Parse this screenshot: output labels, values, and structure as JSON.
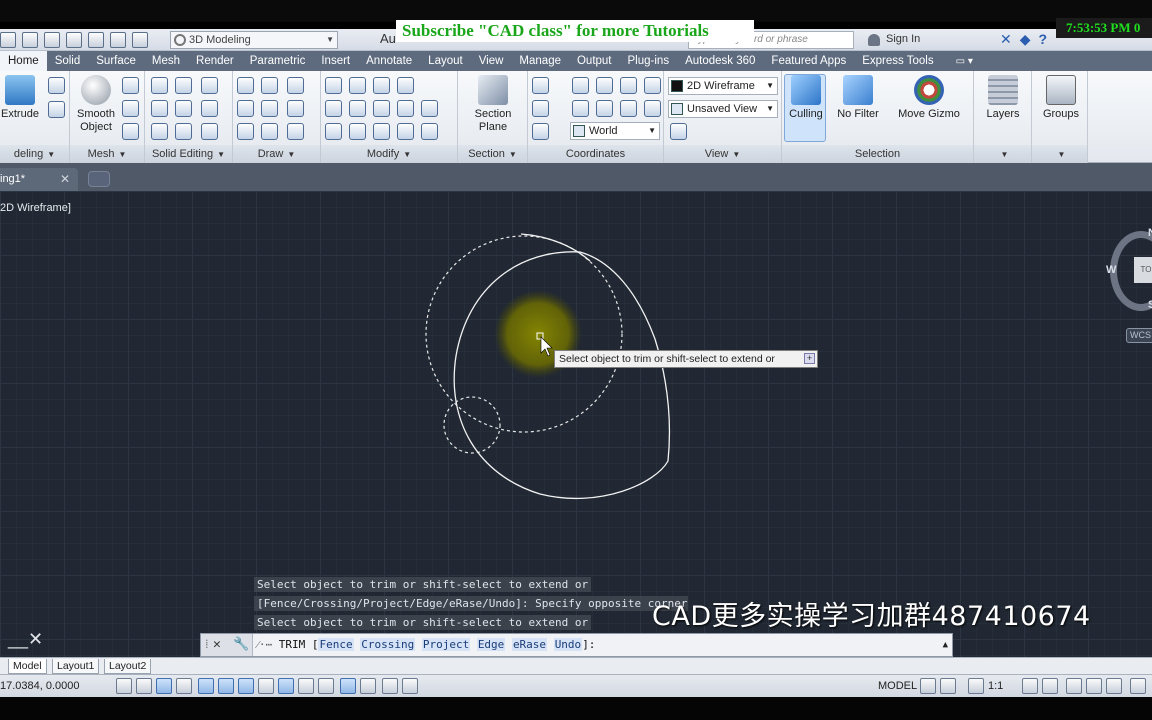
{
  "overlay": {
    "clock": "7:53:53 PM 0",
    "subscribe_banner": "Subscribe \"CAD class\" for more Tutorials",
    "watermark": "CAD更多实操学习加群487410674"
  },
  "qat": {
    "workspace": "3D Modeling",
    "app_title": "Au",
    "search_placeholder": "Type a keyword or phrase",
    "sign_in": "Sign In"
  },
  "tabs": [
    "Home",
    "Solid",
    "Surface",
    "Mesh",
    "Render",
    "Parametric",
    "Insert",
    "Annotate",
    "Layout",
    "View",
    "Manage",
    "Output",
    "Plug-ins",
    "Autodesk 360",
    "Featured Apps",
    "Express Tools"
  ],
  "ribbon": {
    "modeling": {
      "title": "deling",
      "btn_extrude": "Extrude"
    },
    "mesh": {
      "title": "Mesh",
      "btn_smooth_1": "Smooth",
      "btn_smooth_2": "Object"
    },
    "solid_editing": {
      "title": "Solid Editing"
    },
    "draw": {
      "title": "Draw"
    },
    "modify": {
      "title": "Modify"
    },
    "section": {
      "title": "Section",
      "btn_1": "Section",
      "btn_2": "Plane"
    },
    "coordinates": {
      "title": "Coordinates",
      "world": "World"
    },
    "view": {
      "title": "View",
      "visual_style": "2D Wireframe",
      "saved_view": "Unsaved View"
    },
    "selection": {
      "title": "Selection",
      "culling": "Culling",
      "no_filter": "No Filter",
      "move_gizmo": "Move Gizmo"
    },
    "layers": "Layers",
    "groups": "Groups"
  },
  "filetab": {
    "name": "ing1*"
  },
  "viewport": {
    "label": "2D Wireframe]",
    "tooltip": "Select object to trim or shift-select to extend or",
    "compass": {
      "n": "N",
      "w": "W",
      "s": "S",
      "face": "TO"
    },
    "wcs": "WCS"
  },
  "cmd_history": [
    "Select object to trim or shift-select to extend or",
    "[Fence/Crossing/Project/Edge/eRase/Undo]: Specify opposite corner:",
    "Select object to trim or shift-select to extend or"
  ],
  "cmdline": {
    "prefix": "TRIM [",
    "options": [
      "Fence",
      "Crossing",
      "Project",
      "Edge",
      "eRase",
      "Undo"
    ],
    "suffix": "]:"
  },
  "layout_tabs": [
    "Model",
    "Layout1",
    "Layout2"
  ],
  "status": {
    "coords": "17.0384, 0.0000",
    "model": "MODEL",
    "scale": "1:1"
  },
  "colors": {
    "canvas_bg": "#212833",
    "ribbon_tabs_bg": "#5e6b7e",
    "subscribe_text": "#1aa61a",
    "clock_text": "#1ee01e",
    "highlight_spot": "#8a8a00"
  }
}
